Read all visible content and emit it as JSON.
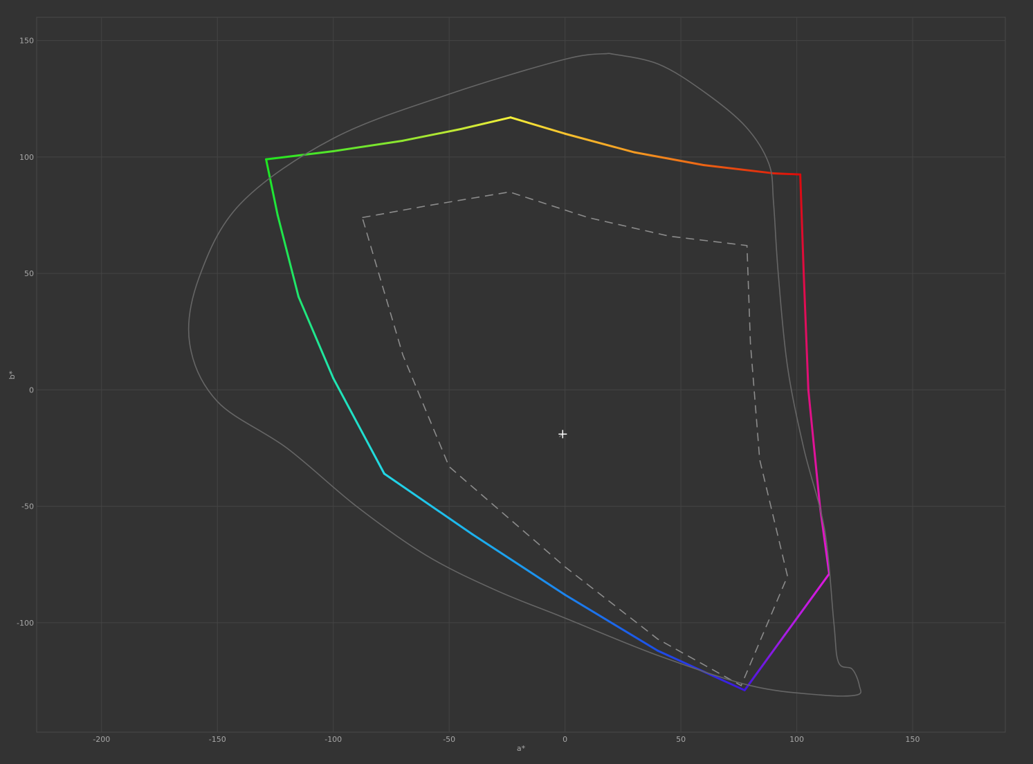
{
  "chart_data": {
    "type": "gamut-plot",
    "xlabel": "a*",
    "ylabel": "b*",
    "xlim": [
      -228,
      190
    ],
    "ylim": [
      -147,
      160
    ],
    "xticks": [
      -200,
      -150,
      -100,
      -50,
      0,
      50,
      100,
      150
    ],
    "yticks": [
      -100,
      -50,
      0,
      50,
      100,
      150
    ],
    "grid": true,
    "colors": {
      "background": "#333333",
      "grid": "#444444",
      "frame": "#4a4a4a",
      "tick_text": "#a8a8a8",
      "reference_outline": "#666666",
      "dashed_outline": "#8c8c8c",
      "white_point": "#ffffff"
    },
    "series": [
      {
        "style": "solid-gradient",
        "points": [
          {
            "a": -129,
            "b": 99,
            "color": "#1fe61f"
          },
          {
            "a": -100,
            "b": 102.5,
            "color": "#58e62c"
          },
          {
            "a": -70,
            "b": 107,
            "color": "#90e630"
          },
          {
            "a": -45,
            "b": 112,
            "color": "#c6e836"
          },
          {
            "a": -23.5,
            "b": 117,
            "color": "#f4f03a"
          },
          {
            "a": 0,
            "b": 110,
            "color": "#f7c22f"
          },
          {
            "a": 30,
            "b": 102,
            "color": "#f49a22"
          },
          {
            "a": 60,
            "b": 96.5,
            "color": "#ec6414"
          },
          {
            "a": 90,
            "b": 93,
            "color": "#e0240c"
          },
          {
            "a": 101.5,
            "b": 92.5,
            "color": "#dc0a0a"
          },
          {
            "a": 103,
            "b": 50,
            "color": "#e00c44"
          },
          {
            "a": 105,
            "b": 0,
            "color": "#e0107c"
          },
          {
            "a": 110,
            "b": -50,
            "color": "#e014b4"
          },
          {
            "a": 114,
            "b": -79,
            "color": "#e018dc"
          },
          {
            "a": 95,
            "b": -105,
            "color": "#a81ce4"
          },
          {
            "a": 77.5,
            "b": -129,
            "color": "#4016e0"
          },
          {
            "a": 40,
            "b": -112,
            "color": "#1c4ee8"
          },
          {
            "a": 0,
            "b": -88,
            "color": "#1c84ee"
          },
          {
            "a": -40,
            "b": -62,
            "color": "#1cb2ee"
          },
          {
            "a": -78,
            "b": -36,
            "color": "#22d8e6"
          },
          {
            "a": -100,
            "b": 5,
            "color": "#20e6b0"
          },
          {
            "a": -115,
            "b": 40,
            "color": "#20e670"
          },
          {
            "a": -124,
            "b": 75,
            "color": "#1fe640"
          },
          {
            "a": -129,
            "b": 99,
            "color": "#1fe61f"
          }
        ]
      },
      {
        "style": "dashed",
        "points": [
          {
            "a": -87.5,
            "b": 74
          },
          {
            "a": -60,
            "b": 79
          },
          {
            "a": -24,
            "b": 85
          },
          {
            "a": 10,
            "b": 74
          },
          {
            "a": 45,
            "b": 66
          },
          {
            "a": 78.5,
            "b": 62
          },
          {
            "a": 80,
            "b": 20
          },
          {
            "a": 84,
            "b": -30
          },
          {
            "a": 96,
            "b": -80
          },
          {
            "a": 76,
            "b": -127
          },
          {
            "a": 40,
            "b": -107
          },
          {
            "a": 0,
            "b": -76
          },
          {
            "a": -50,
            "b": -33
          },
          {
            "a": -70,
            "b": 15
          },
          {
            "a": -87.5,
            "b": 74
          }
        ]
      },
      {
        "style": "thin-solid",
        "points": [
          {
            "a": 19,
            "b": 144.5
          },
          {
            "a": 40,
            "b": 140
          },
          {
            "a": 60,
            "b": 128
          },
          {
            "a": 78,
            "b": 113
          },
          {
            "a": 88,
            "b": 97
          },
          {
            "a": 90,
            "b": 80
          },
          {
            "a": 92,
            "b": 50
          },
          {
            "a": 96,
            "b": 10
          },
          {
            "a": 103,
            "b": -25
          },
          {
            "a": 112,
            "b": -60
          },
          {
            "a": 116,
            "b": -100
          },
          {
            "a": 118,
            "b": -117
          },
          {
            "a": 124,
            "b": -120
          },
          {
            "a": 127,
            "b": -127
          },
          {
            "a": 126,
            "b": -131
          },
          {
            "a": 110,
            "b": -131
          },
          {
            "a": 80,
            "b": -127
          },
          {
            "a": 40,
            "b": -114
          },
          {
            "a": 0,
            "b": -98
          },
          {
            "a": -30,
            "b": -86
          },
          {
            "a": -60,
            "b": -71
          },
          {
            "a": -90,
            "b": -50
          },
          {
            "a": -120,
            "b": -25
          },
          {
            "a": -150,
            "b": -5
          },
          {
            "a": -162,
            "b": 20
          },
          {
            "a": -158,
            "b": 48
          },
          {
            "a": -140,
            "b": 80
          },
          {
            "a": -100,
            "b": 108
          },
          {
            "a": -50,
            "b": 127
          },
          {
            "a": 0,
            "b": 142
          },
          {
            "a": 19,
            "b": 144.5
          }
        ]
      }
    ],
    "white_point": {
      "a": -1,
      "b": -19
    }
  }
}
